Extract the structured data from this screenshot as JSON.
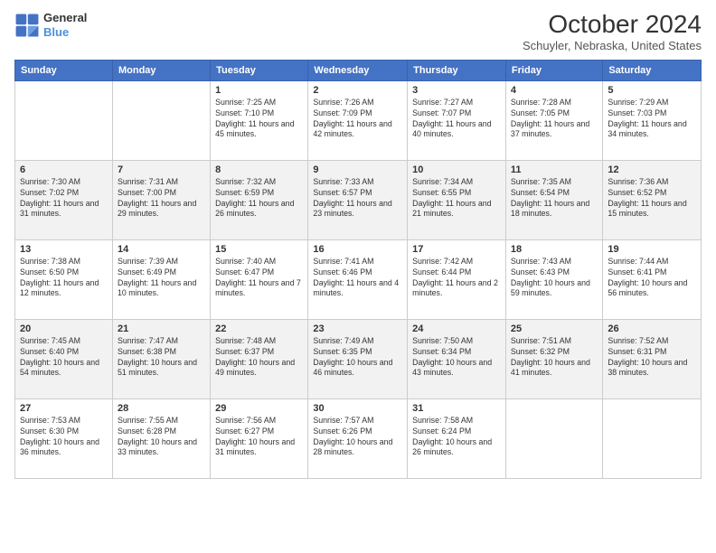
{
  "header": {
    "logo_line1": "General",
    "logo_line2": "Blue",
    "title": "October 2024",
    "location": "Schuyler, Nebraska, United States"
  },
  "days_of_week": [
    "Sunday",
    "Monday",
    "Tuesday",
    "Wednesday",
    "Thursday",
    "Friday",
    "Saturday"
  ],
  "weeks": [
    [
      {
        "day": "",
        "sunrise": "",
        "sunset": "",
        "daylight": ""
      },
      {
        "day": "",
        "sunrise": "",
        "sunset": "",
        "daylight": ""
      },
      {
        "day": "1",
        "sunrise": "Sunrise: 7:25 AM",
        "sunset": "Sunset: 7:10 PM",
        "daylight": "Daylight: 11 hours and 45 minutes."
      },
      {
        "day": "2",
        "sunrise": "Sunrise: 7:26 AM",
        "sunset": "Sunset: 7:09 PM",
        "daylight": "Daylight: 11 hours and 42 minutes."
      },
      {
        "day": "3",
        "sunrise": "Sunrise: 7:27 AM",
        "sunset": "Sunset: 7:07 PM",
        "daylight": "Daylight: 11 hours and 40 minutes."
      },
      {
        "day": "4",
        "sunrise": "Sunrise: 7:28 AM",
        "sunset": "Sunset: 7:05 PM",
        "daylight": "Daylight: 11 hours and 37 minutes."
      },
      {
        "day": "5",
        "sunrise": "Sunrise: 7:29 AM",
        "sunset": "Sunset: 7:03 PM",
        "daylight": "Daylight: 11 hours and 34 minutes."
      }
    ],
    [
      {
        "day": "6",
        "sunrise": "Sunrise: 7:30 AM",
        "sunset": "Sunset: 7:02 PM",
        "daylight": "Daylight: 11 hours and 31 minutes."
      },
      {
        "day": "7",
        "sunrise": "Sunrise: 7:31 AM",
        "sunset": "Sunset: 7:00 PM",
        "daylight": "Daylight: 11 hours and 29 minutes."
      },
      {
        "day": "8",
        "sunrise": "Sunrise: 7:32 AM",
        "sunset": "Sunset: 6:59 PM",
        "daylight": "Daylight: 11 hours and 26 minutes."
      },
      {
        "day": "9",
        "sunrise": "Sunrise: 7:33 AM",
        "sunset": "Sunset: 6:57 PM",
        "daylight": "Daylight: 11 hours and 23 minutes."
      },
      {
        "day": "10",
        "sunrise": "Sunrise: 7:34 AM",
        "sunset": "Sunset: 6:55 PM",
        "daylight": "Daylight: 11 hours and 21 minutes."
      },
      {
        "day": "11",
        "sunrise": "Sunrise: 7:35 AM",
        "sunset": "Sunset: 6:54 PM",
        "daylight": "Daylight: 11 hours and 18 minutes."
      },
      {
        "day": "12",
        "sunrise": "Sunrise: 7:36 AM",
        "sunset": "Sunset: 6:52 PM",
        "daylight": "Daylight: 11 hours and 15 minutes."
      }
    ],
    [
      {
        "day": "13",
        "sunrise": "Sunrise: 7:38 AM",
        "sunset": "Sunset: 6:50 PM",
        "daylight": "Daylight: 11 hours and 12 minutes."
      },
      {
        "day": "14",
        "sunrise": "Sunrise: 7:39 AM",
        "sunset": "Sunset: 6:49 PM",
        "daylight": "Daylight: 11 hours and 10 minutes."
      },
      {
        "day": "15",
        "sunrise": "Sunrise: 7:40 AM",
        "sunset": "Sunset: 6:47 PM",
        "daylight": "Daylight: 11 hours and 7 minutes."
      },
      {
        "day": "16",
        "sunrise": "Sunrise: 7:41 AM",
        "sunset": "Sunset: 6:46 PM",
        "daylight": "Daylight: 11 hours and 4 minutes."
      },
      {
        "day": "17",
        "sunrise": "Sunrise: 7:42 AM",
        "sunset": "Sunset: 6:44 PM",
        "daylight": "Daylight: 11 hours and 2 minutes."
      },
      {
        "day": "18",
        "sunrise": "Sunrise: 7:43 AM",
        "sunset": "Sunset: 6:43 PM",
        "daylight": "Daylight: 10 hours and 59 minutes."
      },
      {
        "day": "19",
        "sunrise": "Sunrise: 7:44 AM",
        "sunset": "Sunset: 6:41 PM",
        "daylight": "Daylight: 10 hours and 56 minutes."
      }
    ],
    [
      {
        "day": "20",
        "sunrise": "Sunrise: 7:45 AM",
        "sunset": "Sunset: 6:40 PM",
        "daylight": "Daylight: 10 hours and 54 minutes."
      },
      {
        "day": "21",
        "sunrise": "Sunrise: 7:47 AM",
        "sunset": "Sunset: 6:38 PM",
        "daylight": "Daylight: 10 hours and 51 minutes."
      },
      {
        "day": "22",
        "sunrise": "Sunrise: 7:48 AM",
        "sunset": "Sunset: 6:37 PM",
        "daylight": "Daylight: 10 hours and 49 minutes."
      },
      {
        "day": "23",
        "sunrise": "Sunrise: 7:49 AM",
        "sunset": "Sunset: 6:35 PM",
        "daylight": "Daylight: 10 hours and 46 minutes."
      },
      {
        "day": "24",
        "sunrise": "Sunrise: 7:50 AM",
        "sunset": "Sunset: 6:34 PM",
        "daylight": "Daylight: 10 hours and 43 minutes."
      },
      {
        "day": "25",
        "sunrise": "Sunrise: 7:51 AM",
        "sunset": "Sunset: 6:32 PM",
        "daylight": "Daylight: 10 hours and 41 minutes."
      },
      {
        "day": "26",
        "sunrise": "Sunrise: 7:52 AM",
        "sunset": "Sunset: 6:31 PM",
        "daylight": "Daylight: 10 hours and 38 minutes."
      }
    ],
    [
      {
        "day": "27",
        "sunrise": "Sunrise: 7:53 AM",
        "sunset": "Sunset: 6:30 PM",
        "daylight": "Daylight: 10 hours and 36 minutes."
      },
      {
        "day": "28",
        "sunrise": "Sunrise: 7:55 AM",
        "sunset": "Sunset: 6:28 PM",
        "daylight": "Daylight: 10 hours and 33 minutes."
      },
      {
        "day": "29",
        "sunrise": "Sunrise: 7:56 AM",
        "sunset": "Sunset: 6:27 PM",
        "daylight": "Daylight: 10 hours and 31 minutes."
      },
      {
        "day": "30",
        "sunrise": "Sunrise: 7:57 AM",
        "sunset": "Sunset: 6:26 PM",
        "daylight": "Daylight: 10 hours and 28 minutes."
      },
      {
        "day": "31",
        "sunrise": "Sunrise: 7:58 AM",
        "sunset": "Sunset: 6:24 PM",
        "daylight": "Daylight: 10 hours and 26 minutes."
      },
      {
        "day": "",
        "sunrise": "",
        "sunset": "",
        "daylight": ""
      },
      {
        "day": "",
        "sunrise": "",
        "sunset": "",
        "daylight": ""
      }
    ]
  ]
}
